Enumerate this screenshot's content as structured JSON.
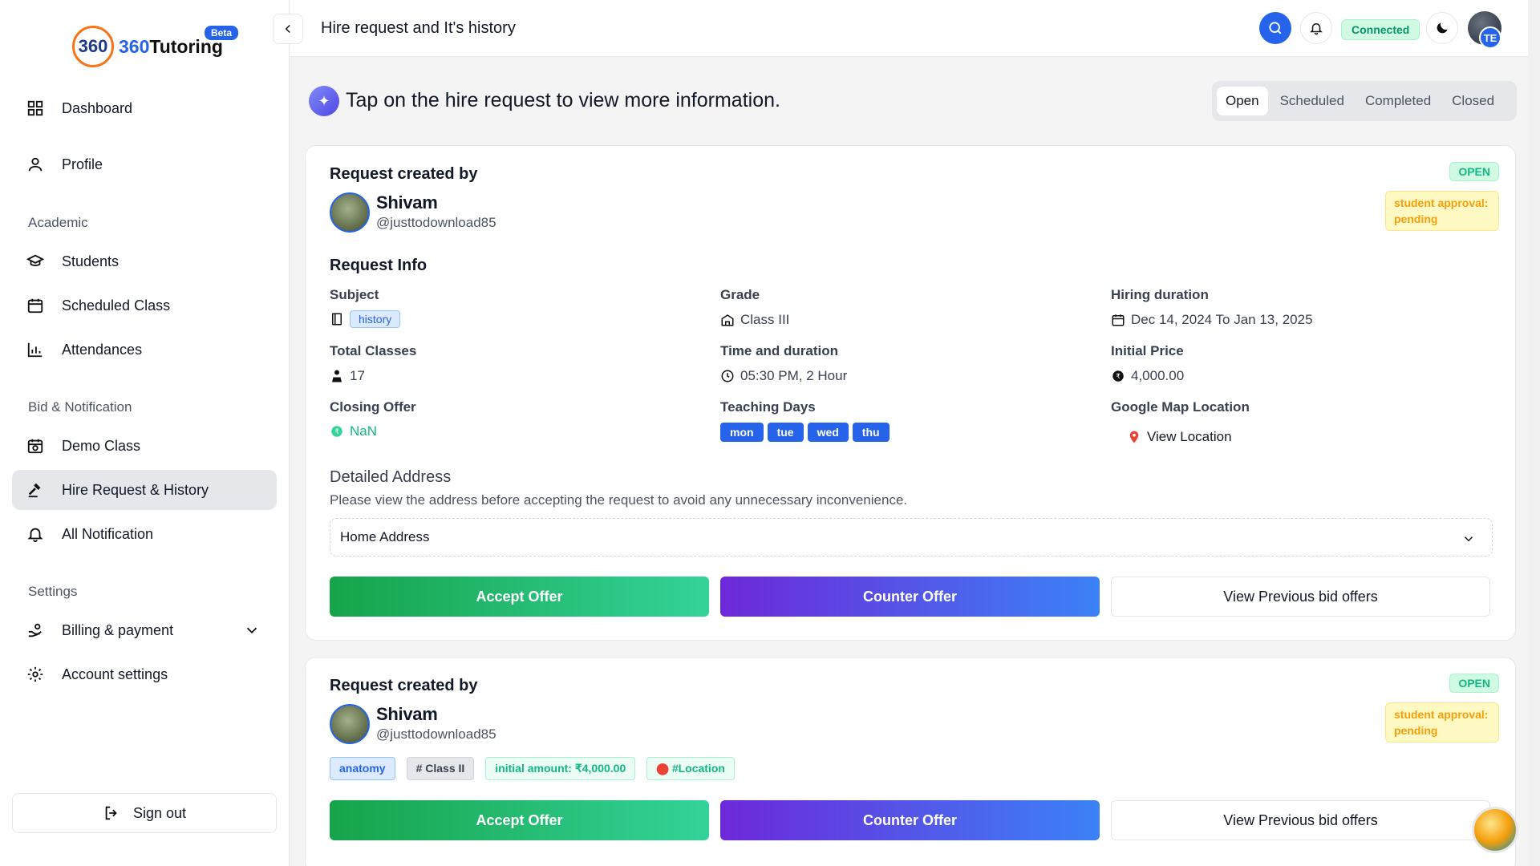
{
  "brand": {
    "name_num": "360",
    "name_text": "Tutoring",
    "mark": "360",
    "beta": "Beta"
  },
  "sidebar": {
    "dashboard": "Dashboard",
    "profile": "Profile",
    "academic_section": "Academic",
    "students": "Students",
    "scheduled_class": "Scheduled Class",
    "attendances": "Attendances",
    "bid_section": "Bid & Notification",
    "demo_class": "Demo Class",
    "hire_request": "Hire Request & History",
    "all_notification": "All Notification",
    "settings_section": "Settings",
    "billing": "Billing & payment",
    "account_settings": "Account settings",
    "sign_out": "Sign out"
  },
  "header": {
    "title": "Hire request and It's history",
    "status": "Connected",
    "avatar_initials": "TE"
  },
  "main": {
    "hint": "Tap on the hire request to view more information.",
    "tabs": [
      "Open",
      "Scheduled",
      "Completed",
      "Closed"
    ],
    "active_tab": "Open"
  },
  "request1": {
    "created_by_label": "Request created by",
    "user_name": "Shivam",
    "user_handle": "@justtodownload85",
    "status_badge": "OPEN",
    "approval_badge": "student approval: pending",
    "info_title": "Request Info",
    "subject_label": "Subject",
    "subject_value": "history",
    "grade_label": "Grade",
    "grade_value": "Class III",
    "hiring_duration_label": "Hiring duration",
    "hiring_duration_value": "Dec 14, 2024 To Jan 13, 2025",
    "total_classes_label": "Total Classes",
    "total_classes_value": "17",
    "time_label": "Time and duration",
    "time_value": "05:30 PM, 2 Hour",
    "initial_price_label": "Initial Price",
    "initial_price_value": "4,000.00",
    "closing_offer_label": "Closing Offer",
    "closing_offer_value": "NaN",
    "teaching_days_label": "Teaching Days",
    "teaching_days": [
      "mon",
      "tue",
      "wed",
      "thu"
    ],
    "map_label": "Google Map Location",
    "map_link": "View Location",
    "address_title": "Detailed Address",
    "address_note": "Please view the address before accepting the request to avoid any unnecessary inconvenience.",
    "address_select": "Home Address",
    "accept": "Accept Offer",
    "counter": "Counter Offer",
    "previous": "View Previous bid offers"
  },
  "request2": {
    "created_by_label": "Request created by",
    "user_name": "Shivam",
    "user_handle": "@justtodownload85",
    "status_badge": "OPEN",
    "approval_badge": "student approval: pending",
    "tags": [
      "anatomy",
      "# Class II",
      "initial amount: ₹4,000.00",
      "#Location"
    ],
    "accept": "Accept Offer",
    "counter": "Counter Offer",
    "previous": "View Previous bid offers"
  },
  "colors": {
    "primary": "#2563eb",
    "success": "#10b981",
    "warning": "#f59e0b"
  }
}
